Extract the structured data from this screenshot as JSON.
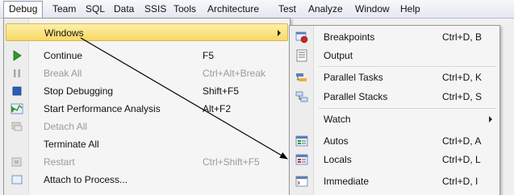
{
  "menubar": {
    "items": [
      {
        "label": "Debug",
        "active": true
      },
      {
        "label": "Team"
      },
      {
        "label": "SQL"
      },
      {
        "label": "Data"
      },
      {
        "label": "SSIS"
      },
      {
        "label": "Tools"
      },
      {
        "label": "Architecture"
      },
      {
        "label": "Test"
      },
      {
        "label": "Analyze"
      },
      {
        "label": "Window"
      },
      {
        "label": "Help"
      }
    ]
  },
  "debug_menu": {
    "items": [
      {
        "label": "Windows",
        "shortcut": "",
        "icon": "none",
        "highlighted": true,
        "has_submenu": true,
        "enabled": true
      },
      {
        "label": "Continue",
        "shortcut": "F5",
        "icon": "continue-play-icon",
        "enabled": true
      },
      {
        "label": "Break All",
        "shortcut": "Ctrl+Alt+Break",
        "icon": "pause-icon",
        "enabled": false
      },
      {
        "label": "Stop Debugging",
        "shortcut": "Shift+F5",
        "icon": "stop-icon",
        "enabled": true
      },
      {
        "label": "Start Performance Analysis",
        "shortcut": "Alt+F2",
        "icon": "performance-chart-icon",
        "enabled": true
      },
      {
        "label": "Detach All",
        "shortcut": "",
        "icon": "detach-icon",
        "enabled": false
      },
      {
        "label": "Terminate All",
        "shortcut": "",
        "icon": "none",
        "enabled": true
      },
      {
        "label": "Restart",
        "shortcut": "Ctrl+Shift+F5",
        "icon": "restart-icon",
        "enabled": false
      },
      {
        "label": "Attach to Process...",
        "shortcut": "",
        "icon": "attach-icon",
        "enabled": true
      }
    ]
  },
  "windows_submenu": {
    "items": [
      {
        "label": "Breakpoints",
        "shortcut": "Ctrl+D, B",
        "icon": "breakpoints-icon"
      },
      {
        "label": "Output",
        "shortcut": "",
        "icon": "output-window-icon"
      },
      {
        "label": "Parallel Tasks",
        "shortcut": "Ctrl+D, K",
        "icon": "parallel-tasks-icon"
      },
      {
        "label": "Parallel Stacks",
        "shortcut": "Ctrl+D, S",
        "icon": "parallel-stacks-icon"
      },
      {
        "label": "Watch",
        "shortcut": "",
        "icon": "none",
        "has_submenu": true
      },
      {
        "label": "Autos",
        "shortcut": "Ctrl+D, A",
        "icon": "autos-icon"
      },
      {
        "label": "Locals",
        "shortcut": "Ctrl+D, L",
        "icon": "locals-icon"
      },
      {
        "label": "Immediate",
        "shortcut": "Ctrl+D, I",
        "icon": "immediate-window-icon"
      }
    ]
  },
  "colors": {
    "menubar_bg": "#e4e8f0",
    "menu_bg": "#f5f5f5",
    "highlight": "#f8d966",
    "disabled_text": "#9a9a9a",
    "stop_blue": "#2b5fb4",
    "continue_green": "#2f9a2f",
    "breakpoint_red": "#c8262c"
  }
}
